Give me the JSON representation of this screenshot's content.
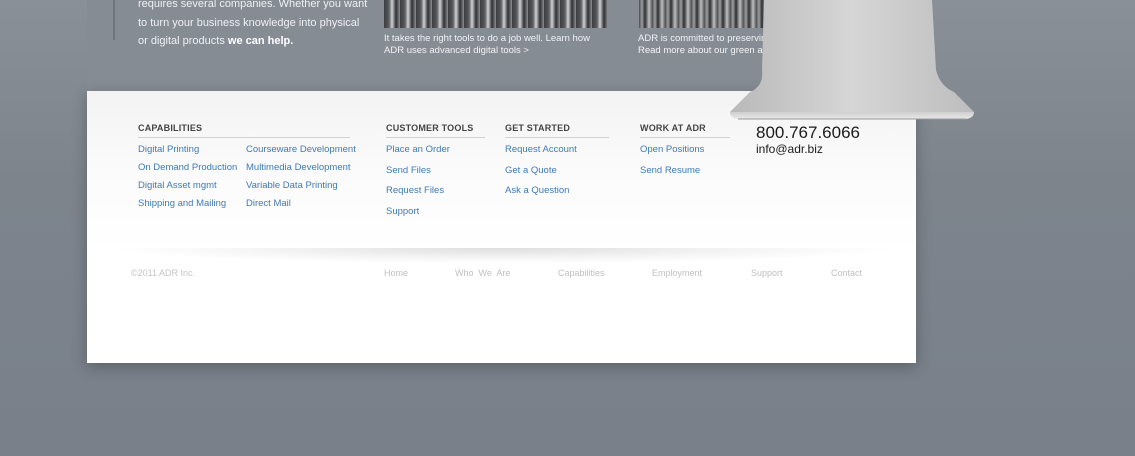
{
  "intro": {
    "line1": "requires several companies. Whether you want",
    "line2": "to turn your business knowledge into physical",
    "line3_prefix": "or digital products ",
    "line3_bold": "we can help."
  },
  "captions": {
    "tools_line1": "It takes the right tools to do a job well. Learn how",
    "tools_line2": "ADR uses advanced digital tools >",
    "green_line1": "ADR is committed to preserving",
    "green_line2": "Read more about our green app"
  },
  "footer": {
    "capabilities": {
      "heading": "CAPABILITIES",
      "col1": [
        "Digital Printing",
        "On Demand Production",
        "Digital Asset mgmt",
        "Shipping and Mailing"
      ],
      "col2": [
        "Courseware Development",
        "Multimedia Development",
        "Variable Data Printing",
        "Direct Mail"
      ]
    },
    "customer_tools": {
      "heading": "CUSTOMER TOOLS",
      "items": [
        "Place an Order",
        "Send Files",
        "Request Files",
        "Support"
      ]
    },
    "get_started": {
      "heading": "GET STARTED",
      "items": [
        "Request Account",
        "Get a Quote",
        "Ask a Question"
      ]
    },
    "work_at_adr": {
      "heading": "WORK AT ADR",
      "items": [
        "Open Positions",
        "Send Resume"
      ]
    },
    "contact": {
      "phone": "800.767.6066",
      "email": "info@adr.biz"
    }
  },
  "bottom": {
    "copyright": "©2011 ADR Inc.",
    "nav": [
      "Home",
      "Who  We  Are",
      "Capabilities",
      "Employment",
      "Support",
      "Contact"
    ]
  },
  "colors": {
    "background": "#7b828b",
    "link": "#3d7ab8",
    "heading": "#444444"
  }
}
